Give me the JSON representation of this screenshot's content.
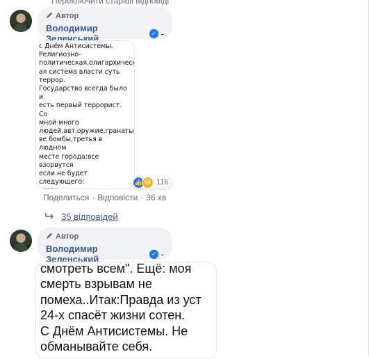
{
  "top_link": "Переключити старіші відповіді",
  "comments": [
    {
      "author_badge": "Автор",
      "author_name": "Володимир Зеленський",
      "verified": true,
      "image_text": "с Днём Антисистемы.\nРелигиозно-\nполитическая,олигархическ\nая система власти суть\nтеррор.\nГосударство всегда было и\nесть первый террорист. Со\nмной много\nлюдей,авт.оружие,гранаты,д\nве бомбы,третья в людном\nместе города;все взорвутся\nесли не будет следующего:\nглавы судов(ксу,вс),высшей\nрады\nправосудия,генпрокурор,ми\nн.юстиции,дир.криминально\n-исполнительной\nсл.,премьер,глава верховной",
      "reactions": {
        "icons": [
          "like-icon",
          "sad-icon"
        ],
        "count": "116"
      },
      "actions": {
        "share": "Поделиться",
        "reply": "Відповісти",
        "time": "36 хв"
      },
      "replies_link": "35 відповідей"
    },
    {
      "author_badge": "Автор",
      "author_name": "Володимир Зеленський",
      "verified": true,
      "image_text": "смотреть всем\". Ещё: моя\nсмерть взрывам не\nпомеха..Итак:Правда из уст\n24-х спасёт жизни сотен.\n С Днём Антисистемы. Не\nобманывайте себя."
    }
  ],
  "colors": {
    "link": "#385898",
    "verified": "#1877f2",
    "bubble": "#f0f2f5",
    "muted": "#65676b"
  }
}
